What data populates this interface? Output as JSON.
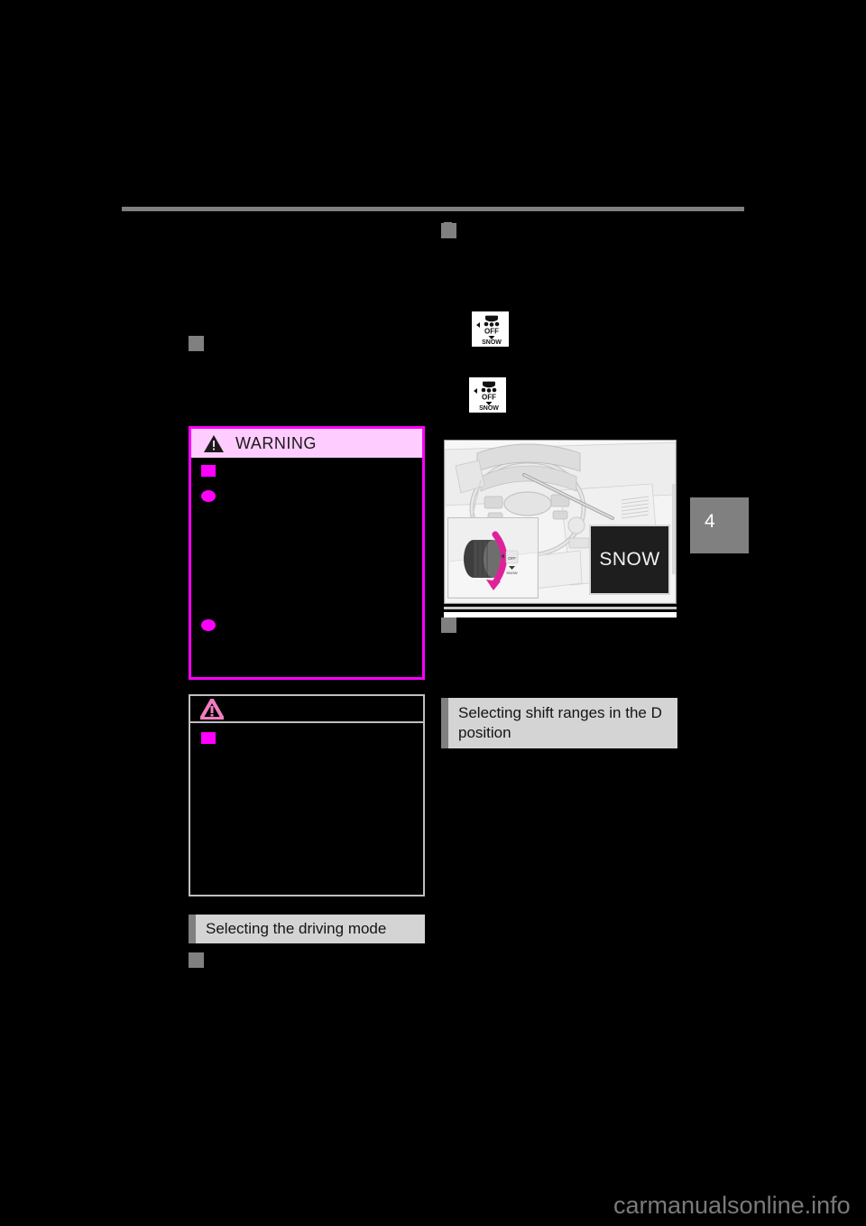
{
  "page": {
    "background_color": "#000000",
    "watermark": "carmanualsonline.info",
    "chapter_tab": {
      "number": "4",
      "color": "#808080"
    }
  },
  "rule": {
    "color": "#808080"
  },
  "left_column": {
    "bullet_top_label": "",
    "warning": {
      "title": "WARNING",
      "header_bg": "#ffccff",
      "border_color": "#ff00ff",
      "icon": "warning-triangle-icon",
      "markers": [
        {
          "type": "square",
          "color": "#ff00ff"
        },
        {
          "type": "bullet",
          "color": "#ff00ff"
        },
        {
          "type": "bullet",
          "color": "#ff00ff"
        }
      ]
    },
    "notice": {
      "title": "",
      "border_color": "#bfbfbf",
      "icon": "notice-triangle-icon",
      "markers": [
        {
          "type": "square",
          "color": "#ff00ff"
        }
      ]
    },
    "driving_mode_heading": "Selecting the driving mode",
    "bullet_below_heading_label": ""
  },
  "right_column": {
    "section_bullet_label": "",
    "snow_switch_icons": [
      {
        "name": "vsc-off-snow-switch-icon-1",
        "labels": [
          "OFF",
          "SNOW"
        ]
      },
      {
        "name": "vsc-off-snow-switch-icon-2",
        "labels": [
          "OFF",
          "SNOW"
        ]
      }
    ],
    "illustration": {
      "name": "dashboard-snow-mode-illustration",
      "display_text": "SNOW",
      "callout": "snow-mode-knob-callout",
      "arrow_color": "#e0219a"
    },
    "caption_bullet_label": "",
    "shift_ranges_heading": "Selecting shift ranges in the D position"
  },
  "headings_style": {
    "bg": "#d4d4d4",
    "accent": "#808080",
    "text_color": "#141414"
  }
}
